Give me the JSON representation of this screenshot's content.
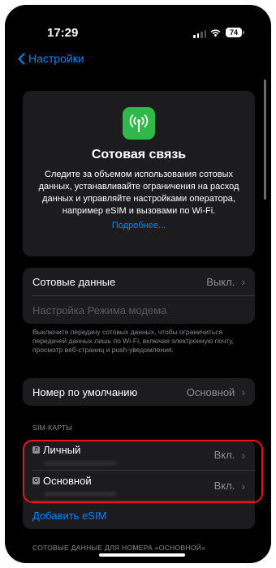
{
  "status": {
    "time": "17:29",
    "battery": "74"
  },
  "nav": {
    "back_label": "Настройки"
  },
  "hero": {
    "title": "Сотовая связь",
    "description": "Следите за объемом использования сотовых данных, устанавливайте ограничения на расход данных и управляйте настройками оператора, например eSIM и вызовами по Wi-Fi.",
    "more_link": "Подробнее..."
  },
  "cellular": {
    "data_label": "Сотовые данные",
    "data_value": "Выкл.",
    "hotspot_label": "Настройка Режима модема",
    "footnote": "Выключите передачу сотовых данных, чтобы ограничиться передачей данных лишь по Wi-Fi, включая электронную почту, просмотр веб-страниц и push-уведомления."
  },
  "default_number": {
    "label": "Номер по умолчанию",
    "value": "Основной"
  },
  "sims": {
    "header": "SIM-КАРТЫ",
    "items": [
      {
        "badge": "Л",
        "label": "Личный",
        "value": "Вкл."
      },
      {
        "badge": "О",
        "label": "Основной",
        "value": "Вкл."
      }
    ],
    "add_esim": "Добавить eSIM"
  },
  "bottom_section": "СОТОВЫЕ ДАННЫЕ ДЛЯ НОМЕРА «ОСНОВНОЙ»",
  "colors": {
    "accent": "#0a84ff",
    "app_icon": "#30b94a",
    "highlight": "#e8141d"
  }
}
